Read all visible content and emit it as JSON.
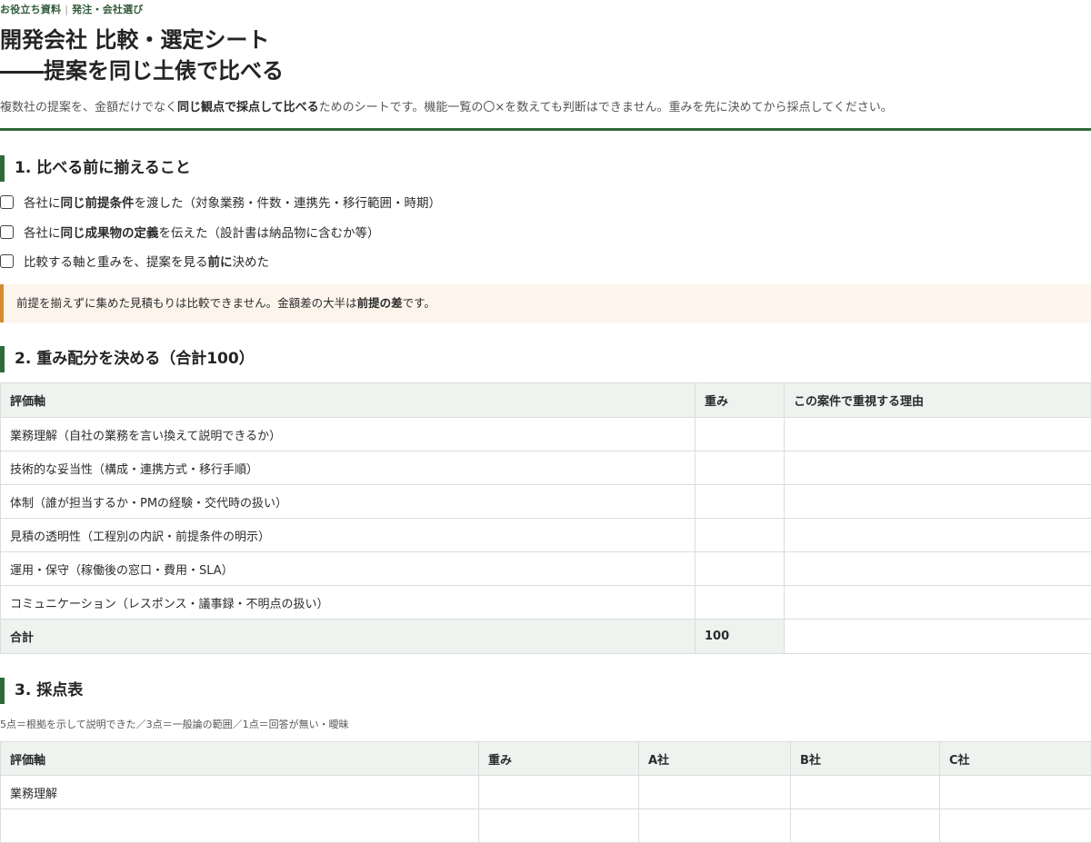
{
  "header": {
    "eyebrow_left": "お役立ち資料",
    "eyebrow_sep": "|",
    "eyebrow_right": "発注・会社選び",
    "title_line1": "開発会社 比較・選定シート",
    "title_line2": "――提案を同じ土俵で比べる"
  },
  "lead": {
    "pre": "複数社の提案を、金額だけでなく",
    "bold": "同じ観点で採点して比べる",
    "post": "ためのシートです。機能一覧の〇×を数えても判断はできません。重みを先に決めてから採点してください。"
  },
  "section1": {
    "heading": "1. 比べる前に揃えること",
    "checks": [
      {
        "pre": "各社に",
        "bold": "同じ前提条件",
        "post": "を渡した（対象業務・件数・連携先・移行範囲・時期）",
        "checked": false
      },
      {
        "pre": "各社に",
        "bold": "同じ成果物の定義",
        "post": "を伝えた（設計書は納品物に含むか等）",
        "checked": false
      },
      {
        "pre": "比較する軸と重みを、提案を見る",
        "bold": "前に",
        "post": "決めた",
        "checked": false
      }
    ],
    "note": {
      "pre": "前提を揃えずに集めた見積もりは比較できません。金額差の大半は",
      "bold": "前提の差",
      "post": "です。"
    }
  },
  "section2": {
    "heading": "2. 重み配分を決める（合計100）",
    "columns": [
      "評価軸",
      "重み",
      "この案件で重視する理由"
    ],
    "rows": [
      {
        "axis": "業務理解（自社の業務を言い換えて説明できるか）",
        "weight": "",
        "reason": ""
      },
      {
        "axis": "技術的な妥当性（構成・連携方式・移行手順）",
        "weight": "",
        "reason": ""
      },
      {
        "axis": "体制（誰が担当するか・PMの経験・交代時の扱い）",
        "weight": "",
        "reason": ""
      },
      {
        "axis": "見積の透明性（工程別の内訳・前提条件の明示）",
        "weight": "",
        "reason": ""
      },
      {
        "axis": "運用・保守（稼働後の窓口・費用・SLA）",
        "weight": "",
        "reason": ""
      },
      {
        "axis": "コミュニケーション（レスポンス・議事録・不明点の扱い）",
        "weight": "",
        "reason": ""
      }
    ],
    "total": {
      "label": "合計",
      "value": "100",
      "reason": ""
    }
  },
  "section3": {
    "heading": "3. 採点表",
    "scale": "5点＝根拠を示して説明できた／3点＝一般論の範囲／1点＝回答が無い・曖昧",
    "columns": [
      "評価軸",
      "重み",
      "A社",
      "B社",
      "C社"
    ],
    "rows": [
      {
        "axis": "業務理解",
        "weight": "",
        "a": "",
        "b": "",
        "c": ""
      },
      {
        "axis": "",
        "weight": "",
        "a": "",
        "b": "",
        "c": ""
      }
    ]
  },
  "colors": {
    "accent": "#2e6a3a",
    "header_bg": "#eef3ef",
    "note_bg": "#fdf5ec",
    "note_border": "#d28a33"
  }
}
